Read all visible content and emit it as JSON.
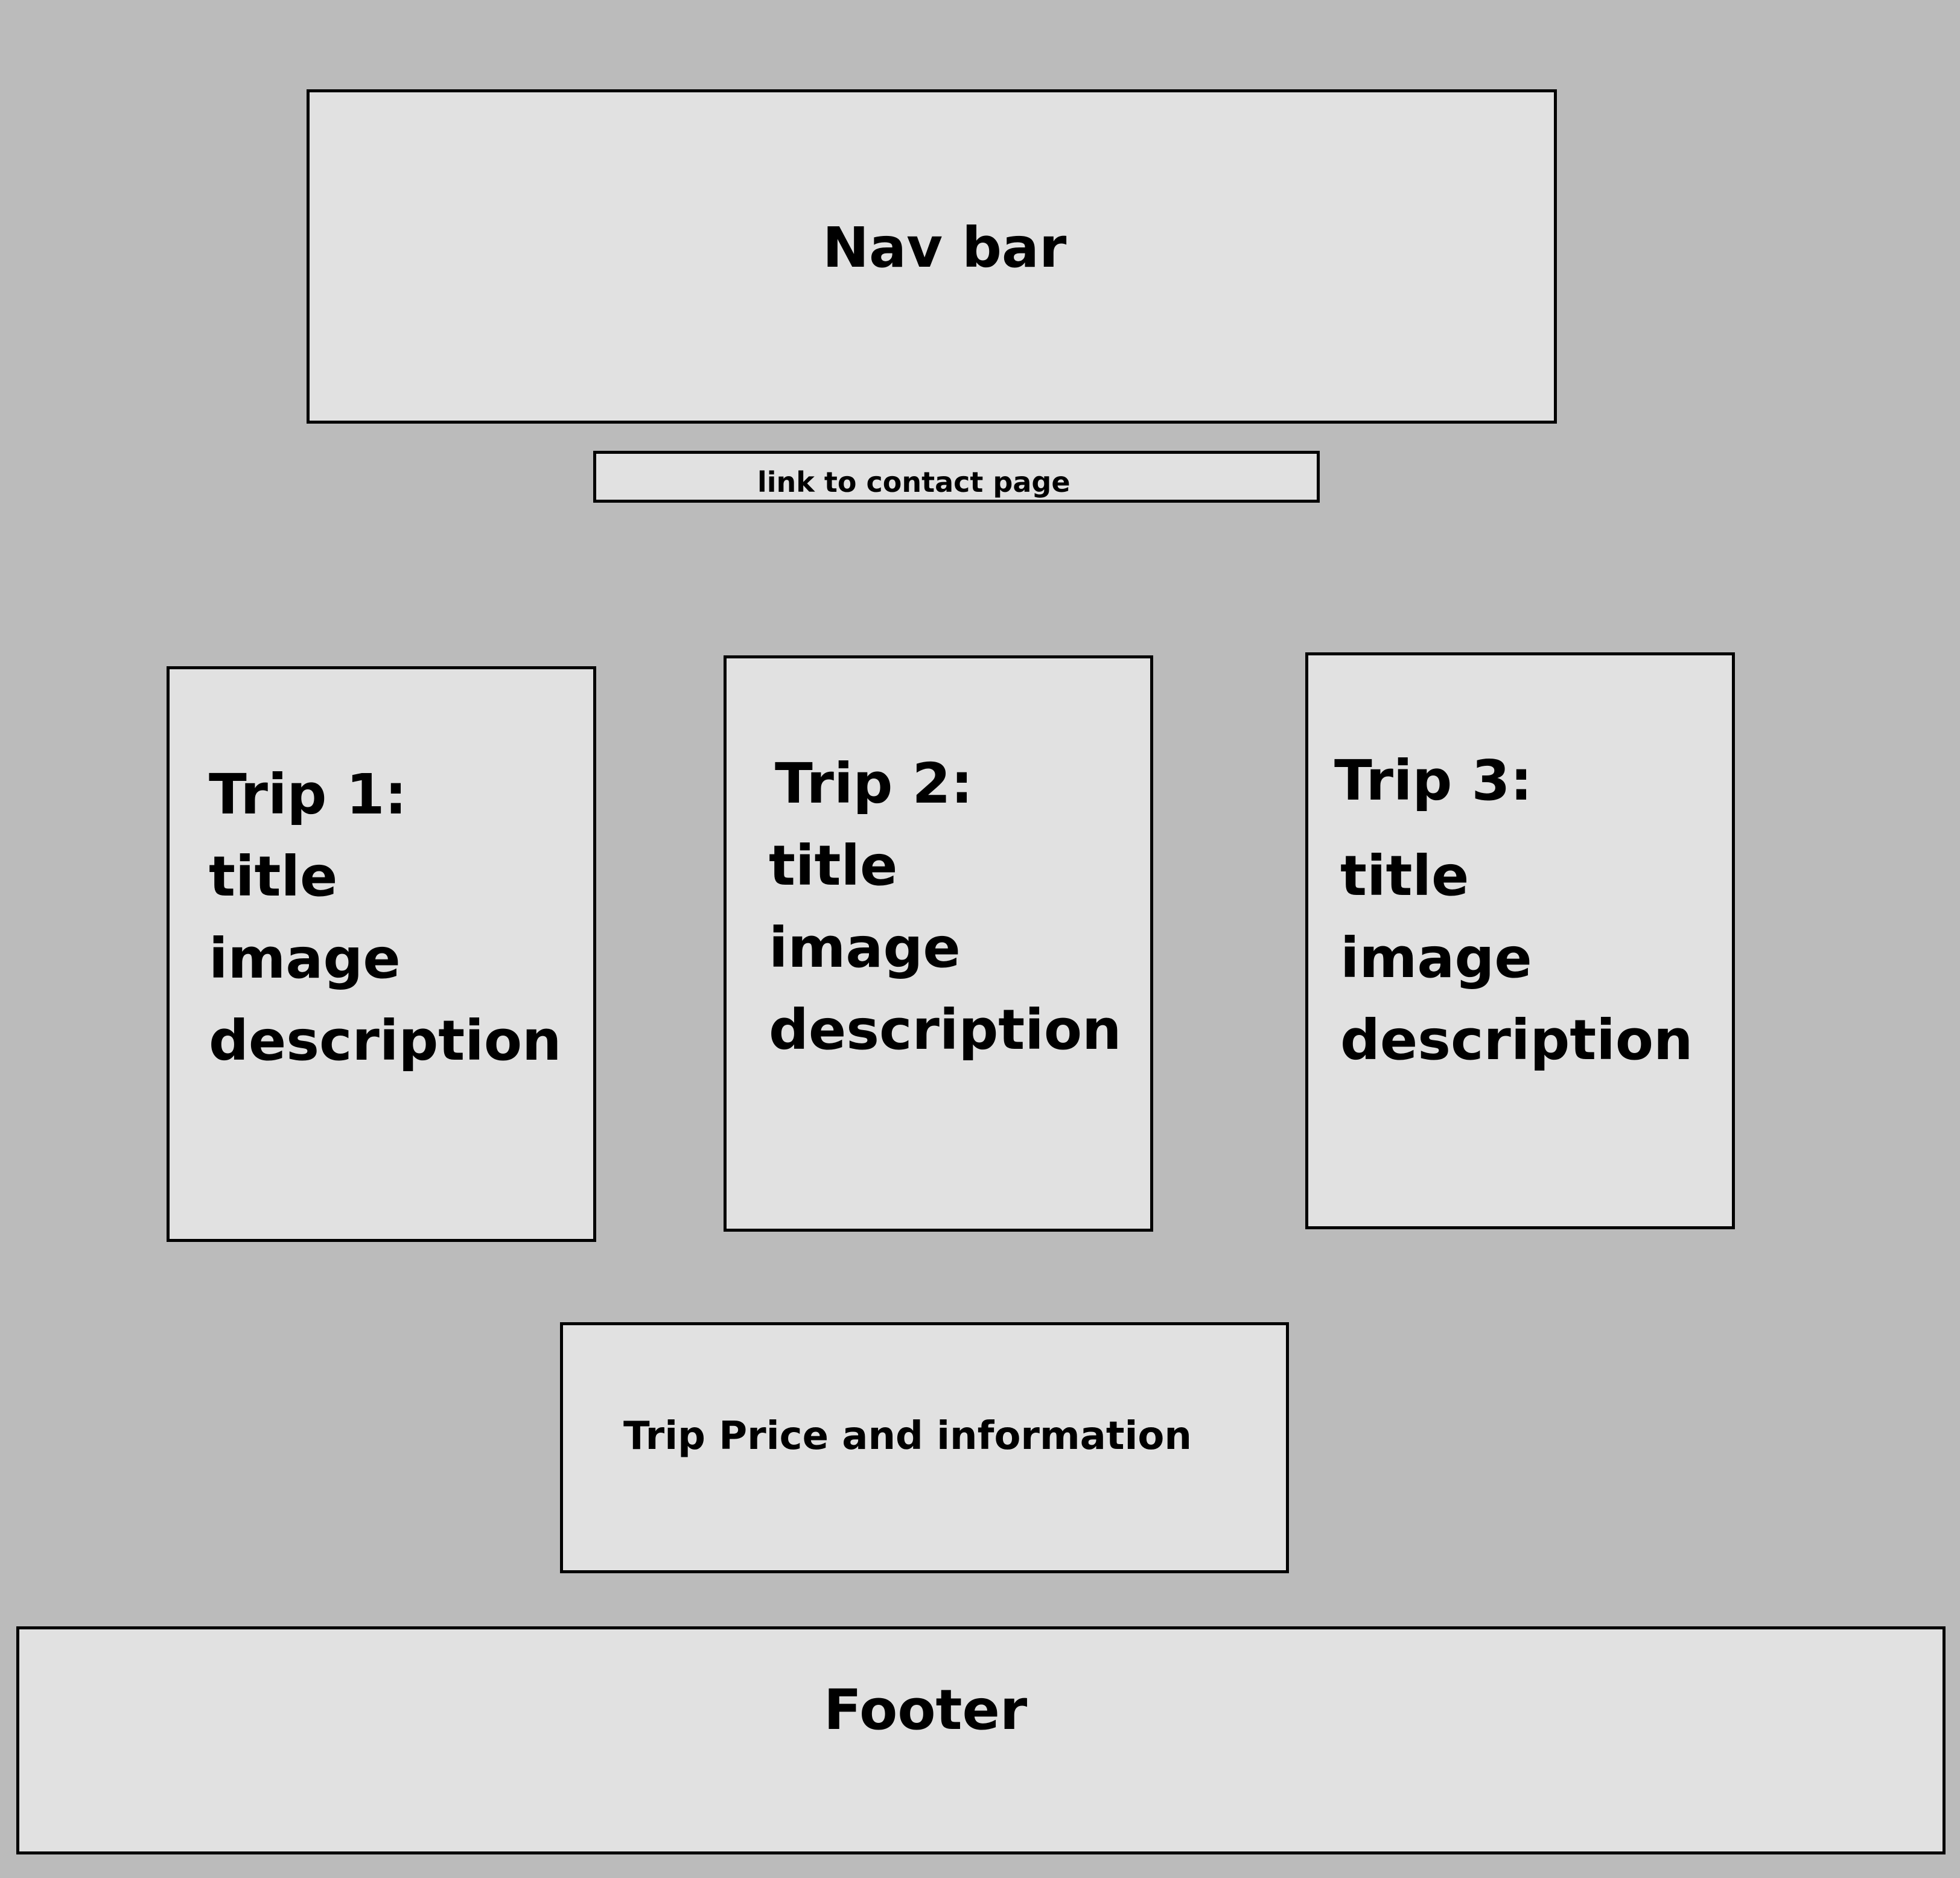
{
  "nav": {
    "label": "Nav bar"
  },
  "contact": {
    "label": "link to contact page"
  },
  "trips": [
    {
      "heading": "Trip 1:",
      "lines": [
        "title",
        "image",
        "description"
      ]
    },
    {
      "heading": "Trip 2:",
      "lines": [
        "title",
        "image",
        "description"
      ]
    },
    {
      "heading": "Trip 3:",
      "lines": [
        "title",
        "image",
        "description"
      ]
    }
  ],
  "price_box": {
    "label": "Trip Price and information"
  },
  "footer": {
    "label": "Footer"
  },
  "colors": {
    "background": "#bbbbbb",
    "box_fill": "#e1e1e1",
    "border": "#000000"
  }
}
